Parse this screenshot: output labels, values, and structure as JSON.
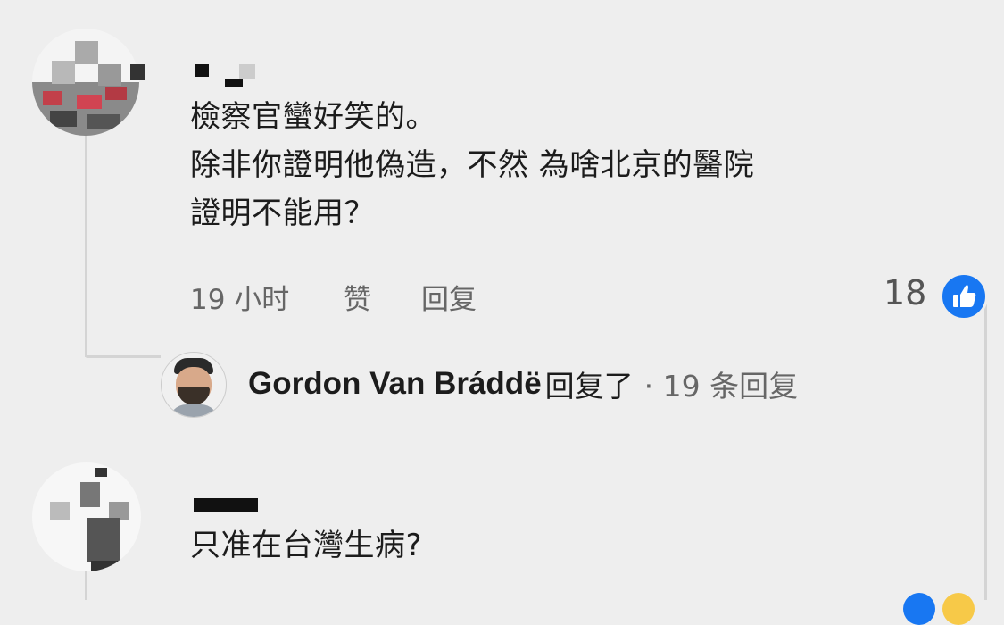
{
  "comment1": {
    "lines": [
      "檢察官蠻好笑的。",
      "除非你證明他偽造，不然 為啥北京的醫院",
      "證明不能用？"
    ],
    "time": "19 小时",
    "like_label": "赞",
    "reply_label": "回复",
    "like_count": "18"
  },
  "reply_preview": {
    "name": "Gordon Van Bráddë",
    "action": "回复了",
    "count": "· 19 条回复"
  },
  "comment2": {
    "text": "只准在台灣生病?"
  },
  "icons": {
    "like": "thumbs-up-icon"
  },
  "colors": {
    "background": "#eeeeee",
    "like_blue": "#1877f2",
    "meta_gray": "#666666"
  }
}
